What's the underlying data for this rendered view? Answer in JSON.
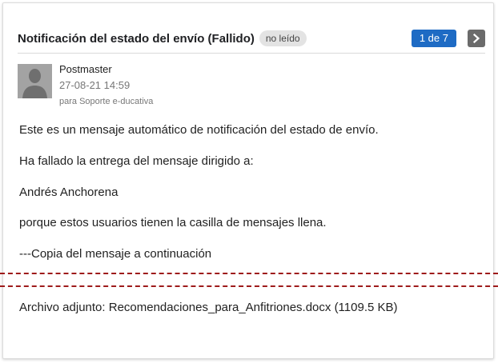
{
  "message": {
    "subject": "Notificación del estado del envío (Fallido)",
    "status_badge": "no leído",
    "pager": "1 de 7"
  },
  "sender": {
    "name": "Postmaster",
    "date": "27-08-21 14:59",
    "recipient": "para Soporte e-ducativa"
  },
  "body": {
    "lines": [
      "Este es un mensaje automático de notificación del estado de envío.",
      "Ha fallado la entrega del mensaje dirigido a:",
      "Andrés Anchorena",
      "porque estos usuarios tienen la casilla de mensajes llena.",
      "---Copia del mensaje a continuación"
    ]
  },
  "attachment": {
    "text": "Archivo adjunto: Recomendaciones_para_Anfitriones.docx (1109.5 KB)"
  },
  "icons": {
    "next": "chevron-right-icon",
    "avatar": "default-user-avatar"
  },
  "colors": {
    "pager_bg": "#1e6bc4",
    "next_button_bg": "#6b6b6b",
    "badge_bg": "#e3e3e3",
    "cut_line": "#9e1b1b"
  }
}
